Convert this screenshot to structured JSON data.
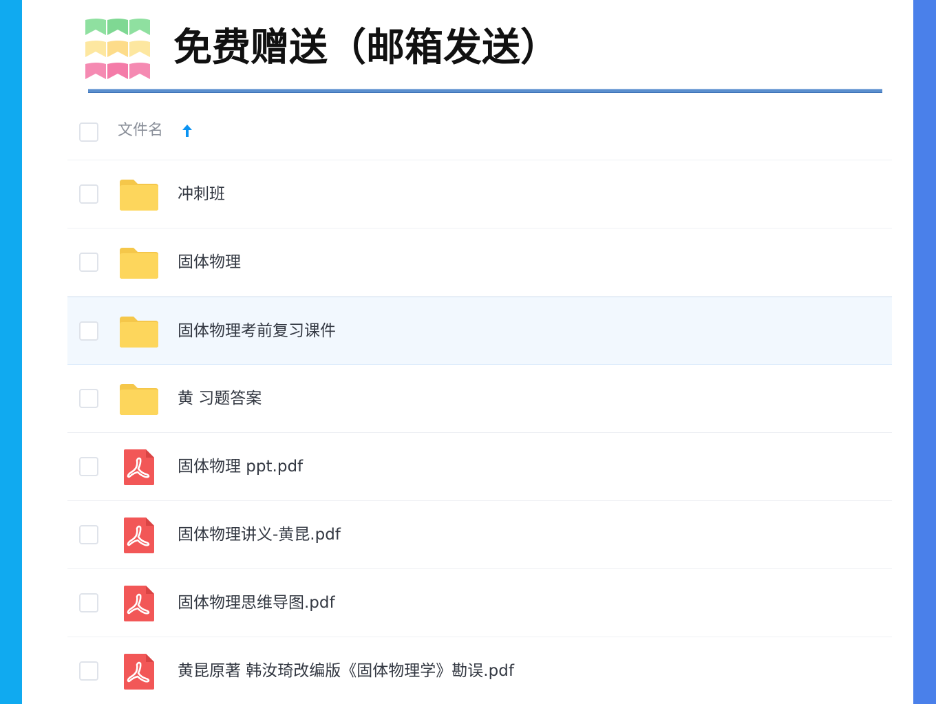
{
  "title": "免费赠送（邮箱发送）",
  "header": {
    "column_label": "文件名",
    "sort_icon": "arrow-up-icon"
  },
  "colors": {
    "left_bar": "#10aaf0",
    "right_bar": "#4a80ea",
    "folder": "#fdd65c",
    "pdf": "#f25757",
    "sort_arrow": "#0b93f2",
    "selected_row": "#f2f8fe"
  },
  "files": [
    {
      "name": "冲刺班",
      "type": "folder",
      "icon": "folder-icon"
    },
    {
      "name": "固体物理",
      "type": "folder",
      "icon": "folder-icon"
    },
    {
      "name": "固体物理考前复习课件",
      "type": "folder",
      "icon": "folder-icon",
      "selected": true
    },
    {
      "name": "黄 习题答案",
      "type": "folder",
      "icon": "folder-icon"
    },
    {
      "name": "固体物理 ppt.pdf",
      "type": "pdf",
      "icon": "pdf-icon"
    },
    {
      "name": "固体物理讲义-黄昆.pdf",
      "type": "pdf",
      "icon": "pdf-icon"
    },
    {
      "name": "固体物理思维导图.pdf",
      "type": "pdf",
      "icon": "pdf-icon"
    },
    {
      "name": "黄昆原著 韩汝琦改编版《固体物理学》勘误.pdf",
      "type": "pdf",
      "icon": "pdf-icon"
    }
  ]
}
